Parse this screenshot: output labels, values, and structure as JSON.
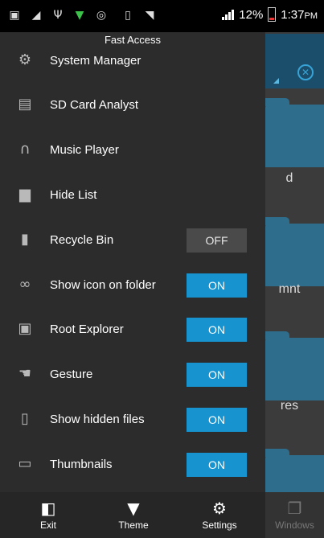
{
  "status_bar": {
    "battery_percent": "12%",
    "time": "1:37",
    "time_suffix": "PM",
    "icons": [
      "notification-icon",
      "signal-icon",
      "usb-icon",
      "download-icon",
      "whatsapp-icon",
      "vibrate-icon",
      "wifi-icon",
      "data-icon",
      "cell-signal-icon",
      "battery-icon"
    ]
  },
  "drawer": {
    "title": "Fast Access",
    "items": [
      {
        "label": "System Manager",
        "icon": "system-manager-icon"
      },
      {
        "label": "SD Card Analyst",
        "icon": "sd-card-icon"
      },
      {
        "label": "Music Player",
        "icon": "headphones-icon"
      },
      {
        "label": "Hide List",
        "icon": "folder-lock-icon"
      },
      {
        "label": "Recycle Bin",
        "icon": "trash-icon",
        "toggle": "OFF"
      },
      {
        "label": "Show icon on folder",
        "icon": "link-icon",
        "toggle": "ON"
      },
      {
        "label": "Root Explorer",
        "icon": "root-explorer-icon",
        "toggle": "ON"
      },
      {
        "label": "Gesture",
        "icon": "gesture-hand-icon",
        "toggle": "ON"
      },
      {
        "label": "Show hidden files",
        "icon": "hidden-file-icon",
        "toggle": "ON"
      },
      {
        "label": "Thumbnails",
        "icon": "thumbnails-icon",
        "toggle": "ON"
      }
    ]
  },
  "background": {
    "folders": [
      "d",
      "mnt",
      "res"
    ]
  },
  "bottom_bar": {
    "exit": "Exit",
    "theme": "Theme",
    "settings": "Settings",
    "windows": "Windows"
  },
  "colors": {
    "accent": "#1793cf",
    "drawer_bg": "#2c2c2c",
    "folder": "#2f6d8d"
  }
}
